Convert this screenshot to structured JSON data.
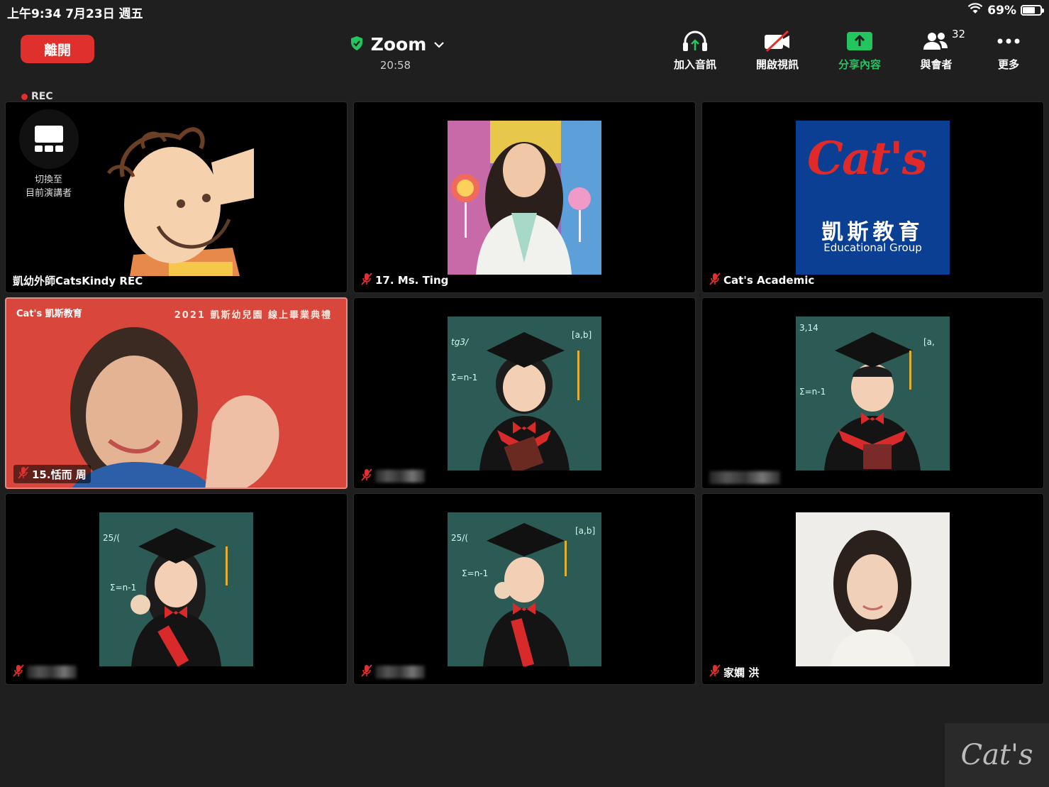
{
  "status_bar": {
    "time": "上午9:34   7月23日 週五",
    "battery": "69%",
    "battery_level": 0.69
  },
  "header": {
    "leave_label": "離開",
    "meeting_title": "Zoom",
    "elapsed": "20:58"
  },
  "toolbar": {
    "join_audio": "加入音訊",
    "start_video": "開啟視訊",
    "share_content": "分享內容",
    "participants": "與會者",
    "participant_count": "32",
    "more": "更多"
  },
  "recording": {
    "label": "REC"
  },
  "switch_speaker": {
    "line1": "切換至",
    "line2": "目前演講者"
  },
  "tiles": [
    {
      "name": "凱幼外師CatsKindy REC",
      "muted": false
    },
    {
      "name": "17. Ms. Ting",
      "muted": true
    },
    {
      "name": "Cat's Academic",
      "muted": true
    },
    {
      "name": "15.恬而 周",
      "muted": true,
      "active": true
    },
    {
      "name": "",
      "muted": true
    },
    {
      "name": "",
      "muted": true
    },
    {
      "name": "",
      "muted": true
    },
    {
      "name": "",
      "muted": true
    },
    {
      "name": "家嫻 洪",
      "muted": true
    }
  ],
  "logo_tile": {
    "brand": "Cat's",
    "chinese": "凱斯教育",
    "english": "Educational Group"
  },
  "banner": {
    "brand": "Cat's 凱斯教育",
    "text": "2021 凱斯幼兒園 線上畢業典禮"
  },
  "watermark": {
    "text": "Cat's"
  },
  "colors": {
    "background": "#1f1f1f",
    "leave_red": "#e0302d",
    "share_green": "#22c55e",
    "logo_blue": "#0b3f93",
    "banner_red": "#d9473c"
  }
}
